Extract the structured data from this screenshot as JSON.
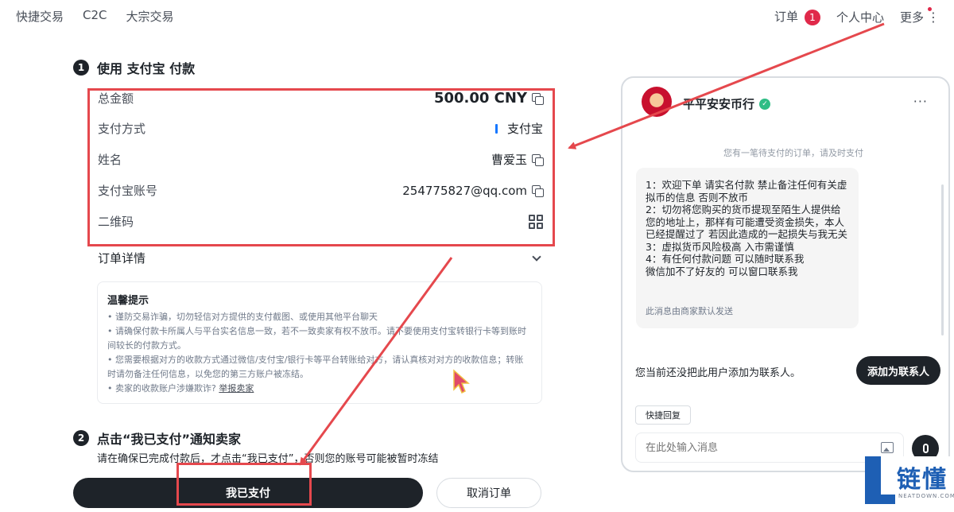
{
  "nav": {
    "left": [
      "快捷交易",
      "C2C",
      "大宗交易"
    ],
    "orders_label": "订单",
    "orders_count": "1",
    "profile_label": "个人中心",
    "more_label": "更多"
  },
  "step1": {
    "num": "1",
    "title": "使用 支付宝 付款",
    "rows": {
      "total_label": "总金额",
      "total_value": "500.00 CNY",
      "method_label": "支付方式",
      "method_value": "支付宝",
      "name_label": "姓名",
      "name_value": "曹爱玉",
      "account_label": "支付宝账号",
      "account_value": "254775827@qq.com",
      "qr_label": "二维码"
    },
    "order_detail_label": "订单详情"
  },
  "tips": {
    "title": "温馨提示",
    "items": [
      "谨防交易诈骗，切勿轻信对方提供的支付截图、或使用其他平台聊天",
      "请确保付款卡所属人与平台实名信息一致，若不一致卖家有权不放币。请不要使用支付宝转银行卡等到账时间较长的付款方式。",
      "您需要根据对方的收款方式通过微信/支付宝/银行卡等平台转账给对方，请认真核对对方的收款信息；转账时请勿备注任何信息，以免您的第三方账户被冻结。",
      "卖家的收款账户涉嫌欺诈?"
    ],
    "report_link": "举报卖家"
  },
  "step2": {
    "num": "2",
    "title": "点击“我已支付”通知卖家",
    "subtitle": "请在确保已完成付款后，才点击“我已支付”，否则您的账号可能被暂时冻结"
  },
  "actions": {
    "paid_label": "我已支付",
    "cancel_label": "取消订单"
  },
  "chat": {
    "merchant_name": "平平安安币行",
    "notice": "您有一笔待支付的订单，请及时支付",
    "message": "1：欢迎下单 请实名付款  禁止备注任何有关虚拟币的信息 否则不放币\n2：切勿将您购买的货币提现至陌生人提供给您的地址上，那样有可能遭受资金损失，本人已经提醒过了 若因此造成的一起损失与我无关\n3：虚拟货币风险极高 入市需谨慎\n4：有任何付款问题  可以随时联系我\n 微信加不了好友的 可以窗口联系我",
    "message_footer": "此消息由商家默认发送",
    "contact_text": "您当前还没把此用户添加为联系人。",
    "add_contact_label": "添加为联系人",
    "quick_reply_label": "快捷回复",
    "input_placeholder": "在此处输入消息"
  },
  "watermark": {
    "cn": "链懂",
    "en": "NEATDOWN.COM"
  },
  "colors": {
    "primary": "#1e2329",
    "annotation_red": "#e5484d",
    "badge_red": "#e0294a",
    "verified_green": "#2ebd85",
    "alipay_blue": "#1677ff",
    "logo_blue": "#1e5fb4"
  }
}
